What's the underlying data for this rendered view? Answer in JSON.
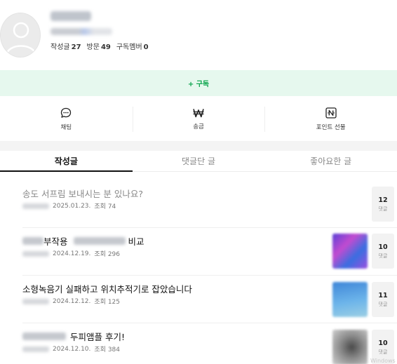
{
  "profile": {
    "stats": [
      {
        "label": "작성글",
        "value": "27"
      },
      {
        "label": "방문",
        "value": "49"
      },
      {
        "label": "구독멤버",
        "value": "0"
      }
    ]
  },
  "subscribe_label": "+ 구독",
  "actions": [
    {
      "label": "채팅",
      "icon": "chat-bubble-icon"
    },
    {
      "label": "송금",
      "icon": "won-icon"
    },
    {
      "label": "포인트 선물",
      "icon": "naver-pay-icon"
    }
  ],
  "tabs": [
    {
      "label": "작성글",
      "active": true
    },
    {
      "label": "댓글단 글",
      "active": false
    },
    {
      "label": "좋아요한 글",
      "active": false
    }
  ],
  "posts": [
    {
      "title": "송도 서프림 보내시는 분 있나요?",
      "date": "2025.01.23.",
      "views": "조회 74",
      "comments": "12",
      "comment_label": "댓글"
    },
    {
      "title_part1": "부작용",
      "title_part2": "비교",
      "date": "2024.12.19.",
      "views": "조회 296",
      "comments": "10",
      "comment_label": "댓글"
    },
    {
      "title": "소형녹음기 실패하고 위치추적기로 잡았습니다",
      "date": "2024.12.12.",
      "views": "조회 125",
      "comments": "11",
      "comment_label": "댓글"
    },
    {
      "title_part2": "두피앰플 후기!",
      "date": "2024.12.10.",
      "views": "조회 384",
      "comments": "10",
      "comment_label": "댓글"
    }
  ],
  "colors": {
    "accent_green": "#08a34a",
    "subscribe_bg": "#e6f8ee"
  },
  "watermark": "Windows"
}
